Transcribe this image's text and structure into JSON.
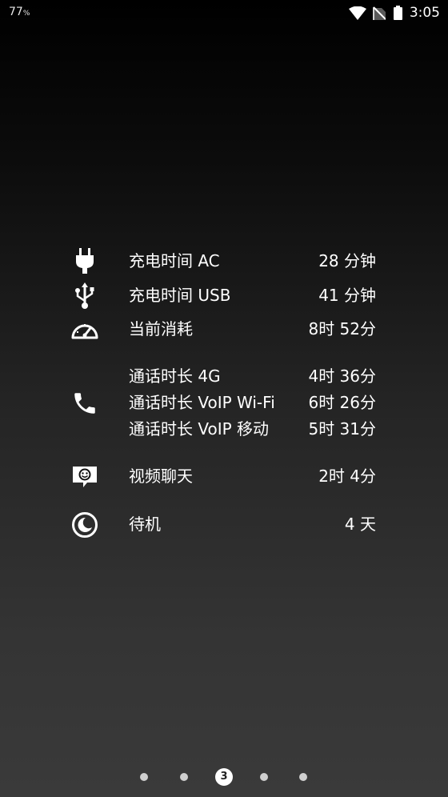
{
  "status_bar": {
    "battery_percent": "77",
    "battery_percent_sign": "%",
    "time": "3:05"
  },
  "stats": {
    "charge_ac": {
      "label": "充电时间 AC",
      "value": "28 分钟",
      "icon": "power-plug-icon"
    },
    "charge_usb": {
      "label": "充电时间 USB",
      "value": "41 分钟",
      "icon": "usb-icon"
    },
    "current_usage": {
      "label": "当前消耗",
      "value": "8时 52分",
      "icon": "speedometer-icon"
    },
    "talk_time": {
      "icon": "phone-icon",
      "items": [
        {
          "label": "通话时长 4G",
          "value": "4时 36分"
        },
        {
          "label": "通话时长 VoIP Wi-Fi",
          "value": "6时 26分"
        },
        {
          "label": "通话时长 VoIP 移动",
          "value": "5时 31分"
        }
      ]
    },
    "video_chat": {
      "label": "视频聊天",
      "value": "2时 4分",
      "icon": "video-chat-icon"
    },
    "standby": {
      "label": "待机",
      "value": "4 天",
      "icon": "moon-icon"
    }
  },
  "pager": {
    "active_page": "3",
    "page_count": 5
  },
  "colors": {
    "foreground": "#ffffff",
    "background_top": "#000000",
    "background_bottom": "#3a3a3a"
  }
}
